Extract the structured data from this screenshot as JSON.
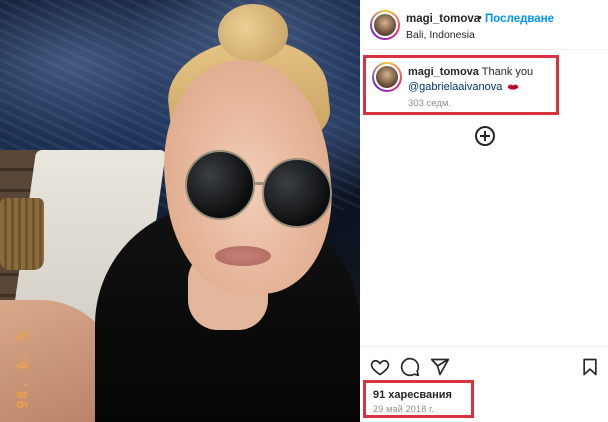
{
  "photo": {
    "date_stamp": "98. 6. 5",
    "alt": "selfie-photo"
  },
  "header": {
    "username": "magi_tomova",
    "separator": "•",
    "follow_label": "Последване",
    "location": "Bali, Indonesia"
  },
  "comment": {
    "username": "magi_tomova",
    "text": "Thank you",
    "mention": "@gabrielaaivanova",
    "emoji": "lips",
    "time": "303 седм."
  },
  "actions": {
    "like": "heart-icon",
    "comment": "comment-icon",
    "share": "share-icon",
    "save": "bookmark-icon"
  },
  "stats": {
    "likes": "91 харесвания",
    "date": "29 май 2018 г."
  },
  "colors": {
    "accent": "#0095f6",
    "highlight": "#d9333f",
    "muted": "#8e8e8e"
  }
}
